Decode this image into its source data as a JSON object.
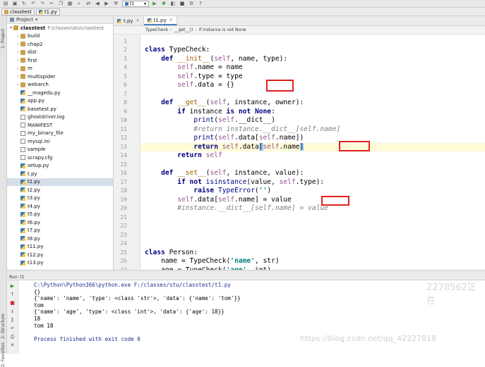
{
  "toolbar": {
    "run_config": "t1"
  },
  "nav": {
    "crumbs": [
      "classtest",
      "t1.py"
    ]
  },
  "left_tabs": [
    "1: Project",
    "2: Structure",
    "2: Favorites"
  ],
  "project": {
    "header": "Project",
    "root_name": "classtest",
    "root_path": "F:\\classes\\stu\\classtest",
    "items": [
      {
        "name": "build",
        "type": "folder"
      },
      {
        "name": "chap2",
        "type": "folder"
      },
      {
        "name": "dist",
        "type": "folder"
      },
      {
        "name": "first",
        "type": "folder"
      },
      {
        "name": "m",
        "type": "folder"
      },
      {
        "name": "multispider",
        "type": "folder"
      },
      {
        "name": "webarch",
        "type": "folder"
      },
      {
        "name": "__magedu.py",
        "type": "py"
      },
      {
        "name": "app.py",
        "type": "py"
      },
      {
        "name": "basetest.py",
        "type": "py"
      },
      {
        "name": "ghostdriver.log",
        "type": "file"
      },
      {
        "name": "MANIFEST",
        "type": "file"
      },
      {
        "name": "my_binary_file",
        "type": "file"
      },
      {
        "name": "mysql.ini",
        "type": "file"
      },
      {
        "name": "sample",
        "type": "file"
      },
      {
        "name": "scrapy.cfg",
        "type": "file"
      },
      {
        "name": "setup.py",
        "type": "py"
      },
      {
        "name": "t.py",
        "type": "py"
      },
      {
        "name": "t1.py",
        "type": "py"
      },
      {
        "name": "t2.py",
        "type": "py"
      },
      {
        "name": "t3.py",
        "type": "py"
      },
      {
        "name": "t4.py",
        "type": "py"
      },
      {
        "name": "t5.py",
        "type": "py"
      },
      {
        "name": "t6.py",
        "type": "py"
      },
      {
        "name": "t7.py",
        "type": "py"
      },
      {
        "name": "t8.py",
        "type": "py"
      },
      {
        "name": "t11.py",
        "type": "py"
      },
      {
        "name": "t12.py",
        "type": "py"
      },
      {
        "name": "t13.py",
        "type": "py"
      }
    ]
  },
  "editor": {
    "tabs": [
      "t.py",
      "t1.py"
    ],
    "active_tab": "t1.py",
    "breadcrumb": [
      "TypeCheck",
      "__get__()",
      "if instance is not None"
    ],
    "line_numbers": [
      "1",
      "2",
      "3",
      "4",
      "5",
      "6",
      "7",
      "8",
      "9",
      "10",
      "11",
      "12",
      "13",
      "14",
      "15",
      "16",
      "17",
      "18",
      "19",
      "20",
      "21",
      "22",
      "23",
      "24",
      "25",
      "26",
      "27"
    ]
  },
  "run": {
    "header": "Run: t1",
    "lines": [
      "C:\\Python\\Python366\\python.exe F:/classes/stu/classtest/t1.py",
      "{}",
      "{'name': 'name', 'type': <class 'str'>, 'data': {'name': 'tom'}}",
      "tom",
      "{'name': 'age', 'type': <class 'int'>, 'data': {'age': 18}}",
      "18",
      "tom 18",
      "",
      "Process finished with exit code 0"
    ]
  },
  "watermarks": {
    "right": "2278562正在",
    "url": "https://blog.csdn.net/qq_42227818"
  },
  "colors": {
    "keyword": "#000080",
    "self": "#94558d",
    "string": "#008080",
    "comment": "#808080",
    "annotation_box": "#e02020",
    "selected_row": "#d5dde9"
  }
}
